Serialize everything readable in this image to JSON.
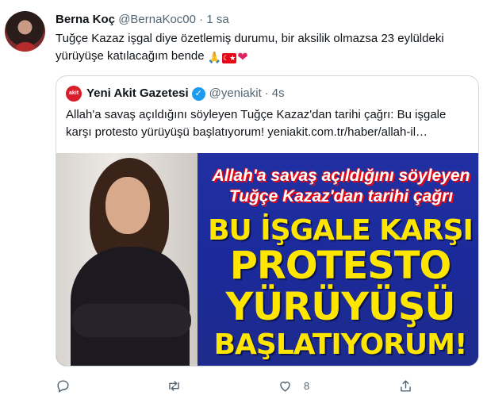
{
  "tweet": {
    "author_name": "Berna Koç",
    "handle": "@BernaKoc00",
    "separator": "·",
    "time": "1 sa",
    "text": "Tuğçe Kazaz işgal diye özetlemiş durumu, bir aksilik olmazsa 23 eylüldeki yürüyüşe katılacağım bende",
    "emojis": [
      "folded-hands-emoji",
      "turkey-flag-emoji",
      "red-heart-emoji"
    ]
  },
  "quote": {
    "logo_text": "akit",
    "author_name": "Yeni Akit Gazetesi",
    "handle": "@yeniakit",
    "separator": "·",
    "time": "4s",
    "text": "Allah'a savaş açıldığını söyleyen Tuğçe Kazaz'dan tarihi çağrı: Bu işgale karşı protesto yürüyüşü başlatıyorum! yeniakit.com.tr/haber/allah-il…",
    "image": {
      "headline_line1": "Allah'a savaş açıldığını söyleyen",
      "headline_line2": "Tuğçe Kazaz'dan tarihi çağrı",
      "big_line1": "BU İŞGALE KARŞI",
      "big_line2": "PROTESTO",
      "big_line3": "YÜRÜYÜŞÜ",
      "big_line4": "BAŞLATIYORUM!"
    }
  },
  "actions": {
    "reply_icon": "reply-icon",
    "retweet_icon": "retweet-icon",
    "like_icon": "heart-icon",
    "like_count": "8",
    "share_icon": "share-icon"
  },
  "colors": {
    "text": "#0f1419",
    "secondary": "#536471",
    "border": "#cfd9de",
    "verified": "#1d9bf0",
    "panel_blue": "#1a2a9a",
    "headline_yellow": "#ffe600",
    "accent_red": "#e30a17"
  }
}
